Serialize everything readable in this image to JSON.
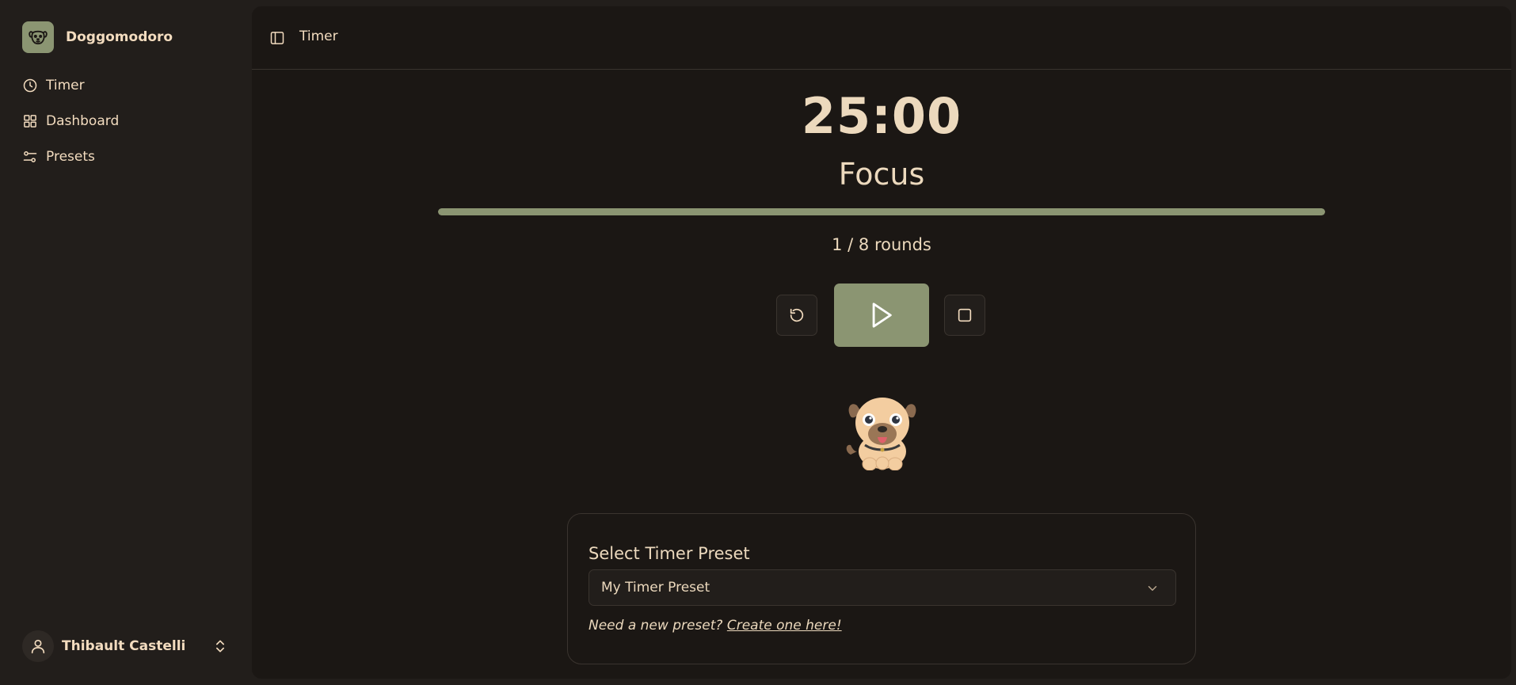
{
  "app": {
    "name": "Doggomodoro"
  },
  "sidebar": {
    "items": [
      {
        "label": "Timer",
        "icon": "clock-icon"
      },
      {
        "label": "Dashboard",
        "icon": "grid-icon"
      },
      {
        "label": "Presets",
        "icon": "sliders-icon"
      }
    ],
    "user": {
      "name": "Thibault Castelli"
    }
  },
  "header": {
    "title": "Timer"
  },
  "timer": {
    "time": "25:00",
    "mode": "Focus",
    "progress": 1.0,
    "rounds": "1 / 8 rounds"
  },
  "preset": {
    "title": "Select Timer Preset",
    "selected": "My Timer Preset",
    "hint": "Need a new preset?",
    "link": "Create one here!"
  },
  "colors": {
    "accent": "#8b9572",
    "text": "#f3dcbf",
    "background": "#1b1714",
    "sidebar": "#221e1b"
  }
}
